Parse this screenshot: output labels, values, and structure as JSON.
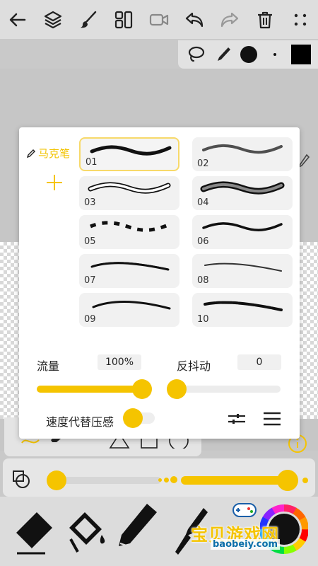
{
  "toolbar": {
    "icons": [
      "back-arrow-icon",
      "layers-icon",
      "brush-icon",
      "panels-icon",
      "video-icon",
      "undo-icon",
      "redo-icon",
      "trash-icon",
      "more-icon"
    ]
  },
  "quick_toolbar": {
    "icons": [
      "lasso-icon",
      "pen-icon",
      "brush-size-dot-icon",
      "small-dot-icon",
      "color-swatch-icon"
    ],
    "current_color": "#000000"
  },
  "brush_dialog": {
    "category_label": "马克笔",
    "brushes": [
      {
        "num": "01",
        "selected": true
      },
      {
        "num": "02",
        "selected": false
      },
      {
        "num": "03",
        "selected": false
      },
      {
        "num": "04",
        "selected": false
      },
      {
        "num": "05",
        "selected": false
      },
      {
        "num": "06",
        "selected": false
      },
      {
        "num": "07",
        "selected": false
      },
      {
        "num": "08",
        "selected": false
      },
      {
        "num": "09",
        "selected": false
      },
      {
        "num": "10",
        "selected": false
      }
    ],
    "flow": {
      "label": "流量",
      "value": "100%"
    },
    "stabilizer": {
      "label": "反抖动",
      "value": "0"
    },
    "speed_pressure": {
      "label": "速度代替压感"
    }
  },
  "watermark": {
    "text": "宝贝游戏网",
    "url": "baobeiy.com"
  },
  "colors": {
    "accent": "#f5c400",
    "toolbar_bg": "#dedede",
    "dialog_bg": "#ffffff"
  }
}
